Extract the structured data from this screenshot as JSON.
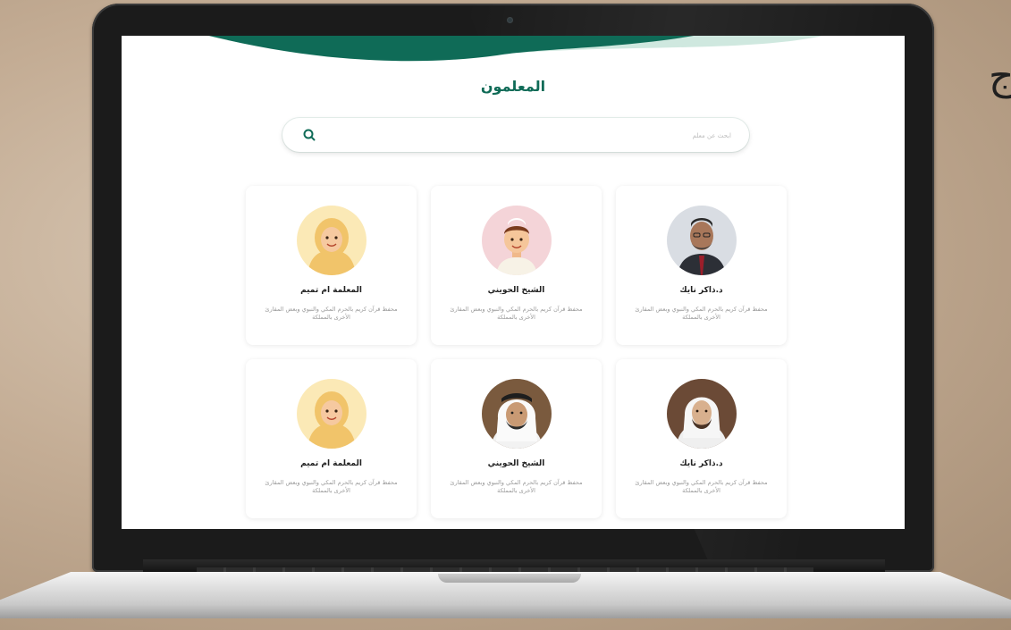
{
  "background_letter": "ج",
  "screen": {
    "page_title": "المعلمون",
    "search": {
      "placeholder": "ابحث عن معلم"
    },
    "teachers": [
      {
        "name": "د.ذاكر نايك",
        "description": "محفظ قرآن كريم بالحرم المكي والنبوي وبعض المقارئ الأخرى بالمملكة",
        "avatar": "photo-man-glasses"
      },
      {
        "name": "الشيخ الحويني",
        "description": "محفظ قرآن كريم بالحرم المكي والنبوي وبعض المقارئ الأخرى بالمملكة",
        "avatar": "cartoon-boy"
      },
      {
        "name": "المعلمة ام تميم",
        "description": "محفظ قرآن كريم بالحرم المكي والنبوي وبعض المقارئ الأخرى بالمملكة",
        "avatar": "cartoon-woman-hijab"
      },
      {
        "name": "د.ذاكر نايك",
        "description": "محفظ قرآن كريم بالحرم المكي والنبوي وبعض المقارئ الأخرى بالمملكة",
        "avatar": "photo-man-white-headdress"
      },
      {
        "name": "الشيخ الحويني",
        "description": "محفظ قرآن كريم بالحرم المكي والنبوي وبعض المقارئ الأخرى بالمملكة",
        "avatar": "photo-man-shemagh"
      },
      {
        "name": "المعلمة ام تميم",
        "description": "محفظ قرآن كريم بالحرم المكي والنبوي وبعض المقارئ الأخرى بالمملكة",
        "avatar": "cartoon-woman-hijab"
      }
    ]
  },
  "colors": {
    "brand_green": "#0f6b57",
    "wave_light": "#cfe8df"
  }
}
